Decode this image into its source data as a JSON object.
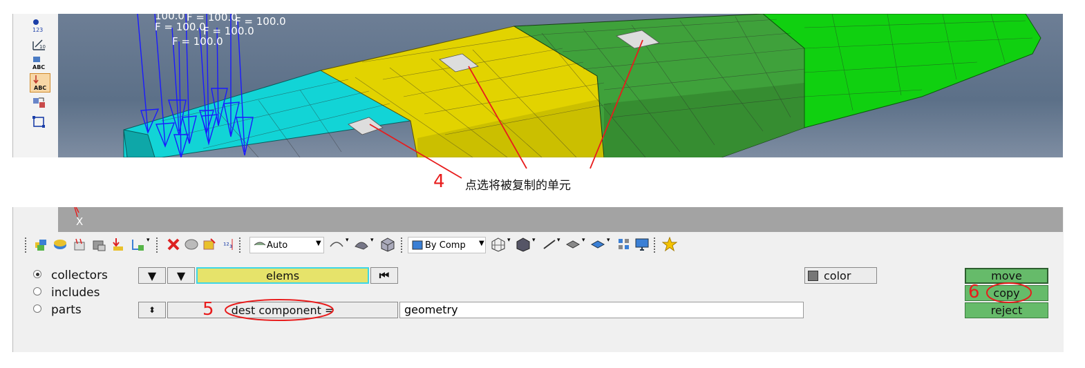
{
  "viewport": {
    "force_labels": [
      "F = 100.0",
      "F = 100.0",
      "F = 100.0",
      "F = 100.0",
      "F = 100.0",
      "F = 100.0",
      "100.0"
    ]
  },
  "annotations": {
    "step4_number": "4",
    "step4_text": "点选将被复制的单元",
    "step5_number": "5",
    "step6_number": "6",
    "highlight_color": "#e81c1c"
  },
  "axis_label": "X",
  "toolbar": {
    "display_combo": "Auto",
    "color_combo": "By Comp"
  },
  "panel": {
    "radios": [
      {
        "label": "collectors",
        "selected": true
      },
      {
        "label": "includes",
        "selected": false
      },
      {
        "label": "parts",
        "selected": false
      }
    ],
    "entity_selector": "elems",
    "dest_component_label": "dest component =",
    "dest_component_value": "geometry",
    "color_button": "color",
    "move_button": "move",
    "copy_button": "copy",
    "reject_button": "reject"
  },
  "colors": {
    "accent_green": "#66bb6a",
    "selector_yellow": "#e6e36a",
    "cyan_component": "#12d4d6",
    "yellow_component": "#e2d300",
    "green_component": "#3fa13b",
    "bright_green_component": "#10d010"
  }
}
